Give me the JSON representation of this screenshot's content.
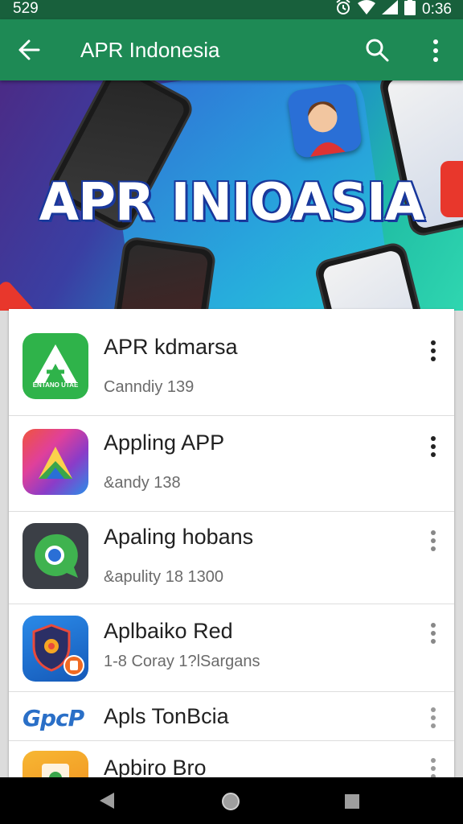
{
  "status_bar": {
    "time_left": "529",
    "time_right": "0:36"
  },
  "app_bar": {
    "title": "APR Indonesia"
  },
  "banner": {
    "heading": "APR INIOASIA"
  },
  "apps": [
    {
      "name": "APR kdmarsa",
      "subtitle": "Canndiy 139",
      "icon": "green-triangle-logo-icon",
      "icon_caption": "ENTANO UTAE",
      "colors": [
        "#2fb34a",
        "#1f9438"
      ]
    },
    {
      "name": "Appling APP",
      "subtitle": "&andy 138",
      "icon": "gradient-play-triangle-icon",
      "colors": [
        "#f0543e",
        "#8a3cc8",
        "#2a8ee8"
      ]
    },
    {
      "name": "Apaling hobans",
      "subtitle": "&apulity 18 1300",
      "icon": "chat-bubble-chrome-icon",
      "colors": [
        "#3b3f46",
        "#3fb34f"
      ]
    },
    {
      "name": "Aplbaiko Red",
      "subtitle": "1-8 Coray 1?lSargans",
      "icon": "shield-badge-icon",
      "colors": [
        "#1b6fd1",
        "#f06a22"
      ]
    },
    {
      "name": "Apls TonBcia",
      "subtitle": "",
      "icon": "gpcp-text-logo-icon",
      "icon_caption": "GpcP",
      "colors": [
        "#2a6fc7"
      ]
    },
    {
      "name": "Apbiro Bro",
      "subtitle": "",
      "icon": "orange-folder-icon",
      "colors": [
        "#f6a623"
      ]
    }
  ],
  "theme": {
    "primary": "#1e8a55",
    "status_bar": "#18603c"
  }
}
